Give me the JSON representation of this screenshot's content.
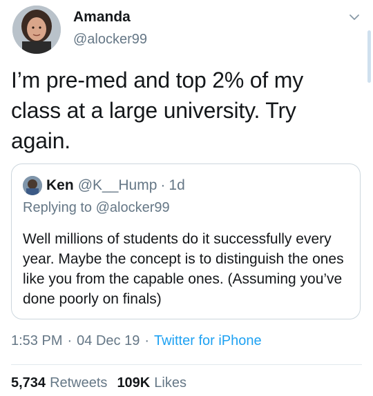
{
  "author": {
    "display_name": "Amanda",
    "handle": "@alocker99"
  },
  "tweet": {
    "text": "I’m pre-med and top 2% of my class at a large university. Try again."
  },
  "quoted": {
    "name": "Ken",
    "handle": "@K__Hump",
    "separator": "·",
    "time": "1d",
    "replying_to_label": "Replying to",
    "replying_to_handle": "@alocker99",
    "text": "Well millions of students do it successfully every year. Maybe the concept is to distinguish the ones like you from the capable ones. (Assuming you’ve done poorly on finals)"
  },
  "meta": {
    "time": "1:53 PM",
    "date": "04 Dec 19",
    "separator": "·",
    "source": "Twitter for iPhone"
  },
  "stats": {
    "retweets_count": "5,734",
    "retweets_label": "Retweets",
    "likes_count": "109K",
    "likes_label": "Likes"
  },
  "colors": {
    "accent": "#1da1f2",
    "secondary_text": "#657786",
    "primary_text": "#14171a",
    "border": "#ccd6dd"
  },
  "icons": {
    "more": "chevron-down-icon"
  }
}
